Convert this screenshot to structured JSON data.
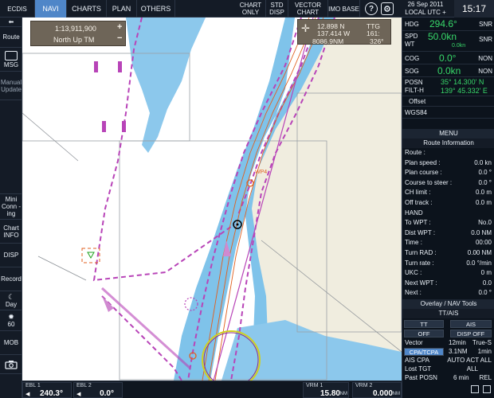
{
  "topbar": {
    "ecdis": "ECDIS",
    "navi": "NAVI",
    "charts": "CHARTS",
    "plan": "PLAN",
    "others": "OTHERS",
    "chart_only": "CHART ONLY",
    "std_disp": "STD DISP",
    "vector_chart": "VECTOR CHART",
    "imo_base": "IMO BASE",
    "help_icon": "?",
    "date": "26 Sep 2011",
    "local_utc": "LOCAL UTC + 9:00",
    "time": "15:17"
  },
  "leftbar": {
    "route": "Route",
    "msg": "MSG",
    "manual_update": "Manual Update",
    "mini_conning": "Mini Conn -ing",
    "chart_info": "Chart INFO",
    "disp": "DISP",
    "record": "Record",
    "day": "Day",
    "brightness": "60",
    "mob": "MOB"
  },
  "chart": {
    "scale": "1:13,911,900",
    "scale_mode": "North Up TM",
    "zoom_in": "+",
    "zoom_out": "−",
    "cursor_lat": "12.898 N",
    "cursor_lon": "137.414 W",
    "ttg_label": "TTG",
    "ttg_value": "161:",
    "distance": "8086.9NM",
    "bearing": "326°",
    "wp_label": "WP4",
    "colors": {
      "land": "#e9e6d6",
      "sea": "#ffffff",
      "shallow": "#8cc8ec",
      "route": "#b844b8",
      "track": "#e06020"
    }
  },
  "bottombar": {
    "ebl1_label": "EBL 1",
    "ebl1_value": "240.3°",
    "ebl2_label": "EBL 2",
    "ebl2_value": "0.0°",
    "vrm1_label": "VRM 1",
    "vrm1_value": "15.80",
    "vrm2_label": "VRM 2",
    "vrm2_value": "0.000",
    "unit_nm": "NM"
  },
  "right": {
    "hdg_label": "HDG",
    "hdg_value": "294.6°",
    "hdg_src": "SNR",
    "spd_label": "SPD",
    "wt_label": "WT",
    "spd_value": "50.0kn",
    "spd_sub": "0.0kn",
    "spd_src": "SNR",
    "cog_label": "COG",
    "cog_value": "0.0°",
    "cog_src": "NON",
    "sog_label": "SOG",
    "sog_value": "0.0kn",
    "sog_src": "NON",
    "posn_label": "POSN",
    "filt_label": "FILT-H",
    "lat": "35° 14.300' N",
    "lon": "139° 45.332' E",
    "offset": "Offset",
    "datum": "WGS84",
    "menu": "MENU",
    "route_info": "Route Information",
    "route_items": [
      {
        "k": "Route :",
        "v": ""
      },
      {
        "k": "Plan speed :",
        "v": "0.0 kn"
      },
      {
        "k": "Plan course :",
        "v": "0.0 °"
      },
      {
        "k": "Course to steer :",
        "v": "0.0 °"
      },
      {
        "k": "CH limit :",
        "v": "0.0 m"
      },
      {
        "k": "Off track :",
        "v": "0.0 m"
      },
      {
        "k": "HAND",
        "v": ""
      },
      {
        "k": "To WPT :",
        "v": "No.0"
      },
      {
        "k": "Dist WPT :",
        "v": "0.0 NM"
      },
      {
        "k": "Time :",
        "v": "00:00"
      },
      {
        "k": "Turn RAD :",
        "v": "0.00 NM"
      },
      {
        "k": "Turn rate :",
        "v": "0.0 °/min"
      },
      {
        "k": "UKC :",
        "v": "0 m"
      },
      {
        "k": "Next WPT :",
        "v": "0.0"
      },
      {
        "k": "Next :",
        "v": "0.0 °"
      }
    ],
    "overlay": "Overlay / NAV Tools",
    "tt_ais": "TT/AIS",
    "tt": "TT",
    "ais": "AIS",
    "off": "OFF",
    "disp_off": "DISP OFF",
    "vector": "Vector",
    "vector_time": "12min",
    "vector_mode": "True-S",
    "cpa_tcpa": "CPA/TCPA",
    "cpa_val": "3.1NM",
    "tcpa_val": "1min",
    "ais_cpa": "AIS CPA",
    "auto_act": "AUTO ACT ALL",
    "lost_tgt": "Lost TGT",
    "all": "ALL",
    "past_posn": "Past POSN",
    "past_time": "6 min",
    "past_mode": "REL"
  }
}
